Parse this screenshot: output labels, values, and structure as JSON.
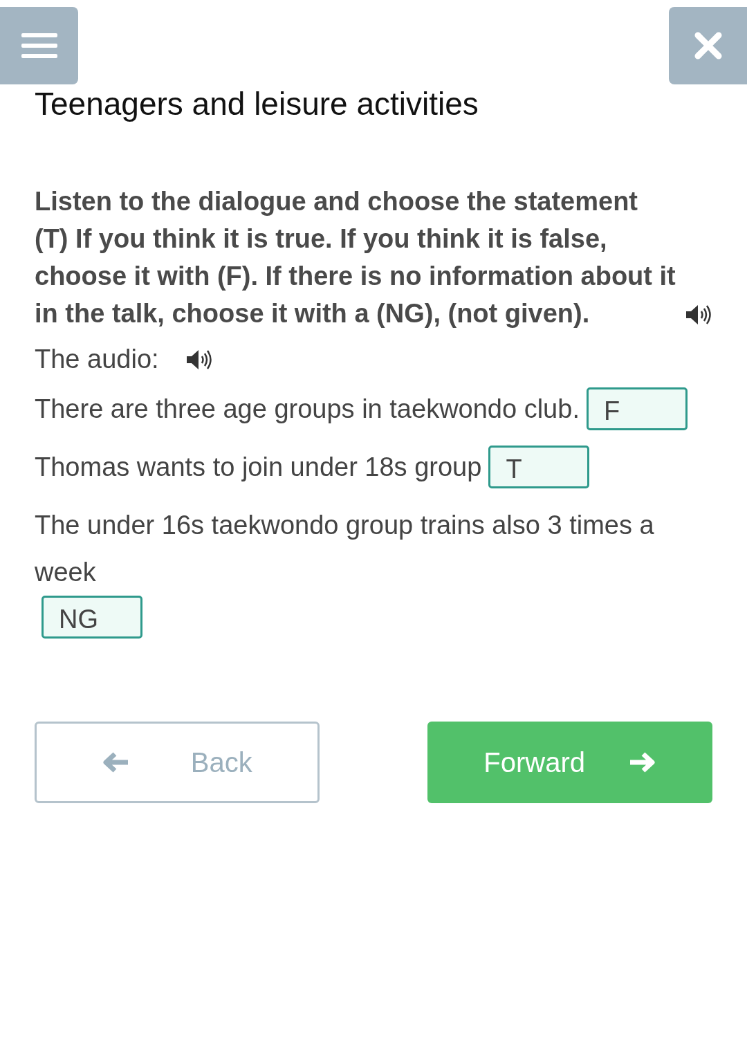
{
  "title": "Teenagers and leisure activities",
  "instruction": "Listen to the dialogue and choose the statement (T) If you think it is true. If you think it is false, choose it with (F). If there is no information about it in the talk, choose it with a (NG), (not given).",
  "audio_label": "The audio:",
  "questions": [
    {
      "text": "There are three age groups in taekwondo club.",
      "answer": "F"
    },
    {
      "text": "Thomas wants to join under 18s group",
      "answer": "T"
    },
    {
      "text": "The under 16s taekwondo group trains also 3 times a week",
      "answer": "NG"
    }
  ],
  "buttons": [
    {
      "kind": "back",
      "label": "Back"
    },
    {
      "kind": "forward",
      "label": "Forward"
    }
  ]
}
